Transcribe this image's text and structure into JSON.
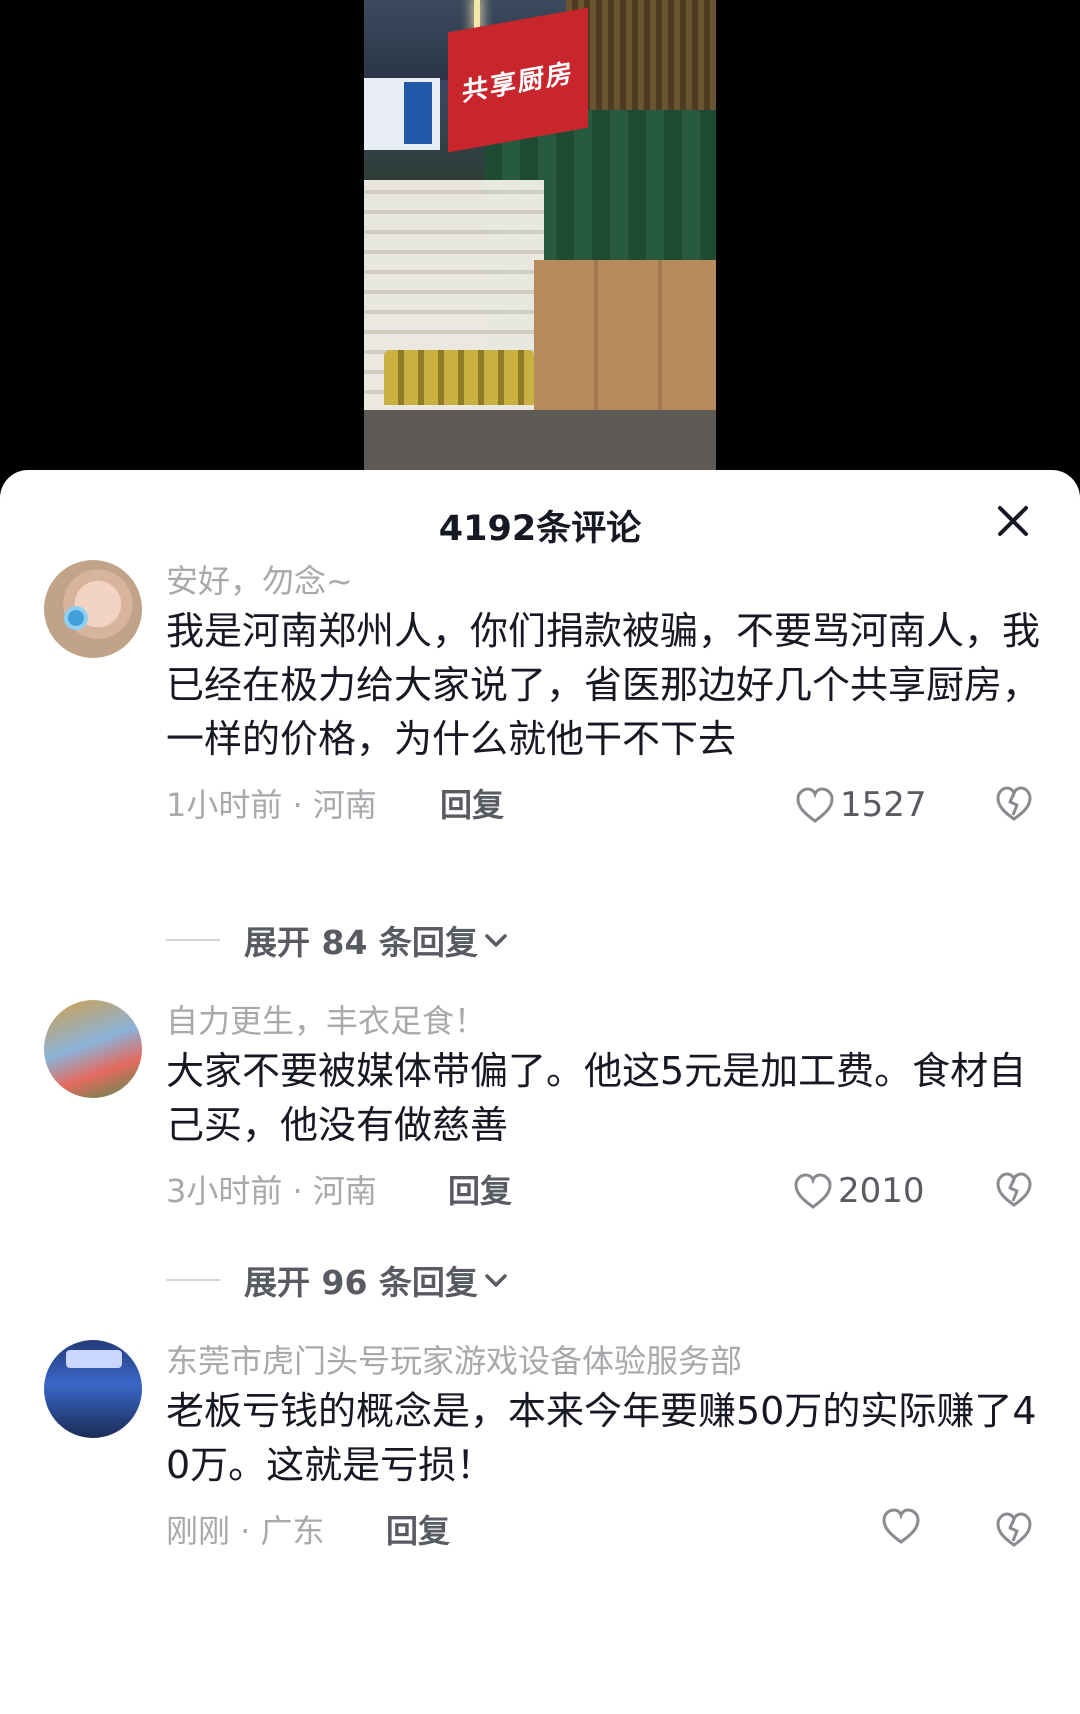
{
  "video": {
    "sign_text": "共享厨房"
  },
  "header": {
    "title": "4192条评论"
  },
  "comments": [
    {
      "username": "安好，勿念~",
      "text": "我是河南郑州人，你们捐款被骗，不要骂河南人，我已经在极力给大家说了，省医那边好几个共享厨房，一样的价格，为什么就他干不下去",
      "time_location": "1小时前 · 河南",
      "reply_label": "回复",
      "likes": "1527",
      "expand_label": "展开 84 条回复"
    },
    {
      "username": "自力更生，丰衣足食！",
      "text": "大家不要被媒体带偏了。他这5元是加工费。食材自己买，他没有做慈善",
      "time_location": "3小时前 · 河南",
      "reply_label": "回复",
      "likes": "2010",
      "expand_label": "展开 96 条回复"
    },
    {
      "username": "东莞市虎门头号玩家游戏设备体验服务部",
      "text": "老板亏钱的概念是，本来今年要赚50万的实际赚了40万。这就是亏损！",
      "time_location": "刚刚 · 广东",
      "reply_label": "回复",
      "likes": ""
    }
  ],
  "icons": {
    "close": "close-icon",
    "like": "heart-icon",
    "dislike": "broken-heart-icon",
    "expand": "chevron-down-icon"
  },
  "colors": {
    "text_primary": "#161823",
    "text_secondary": "#a8a8ad",
    "text_action": "#595b63"
  }
}
